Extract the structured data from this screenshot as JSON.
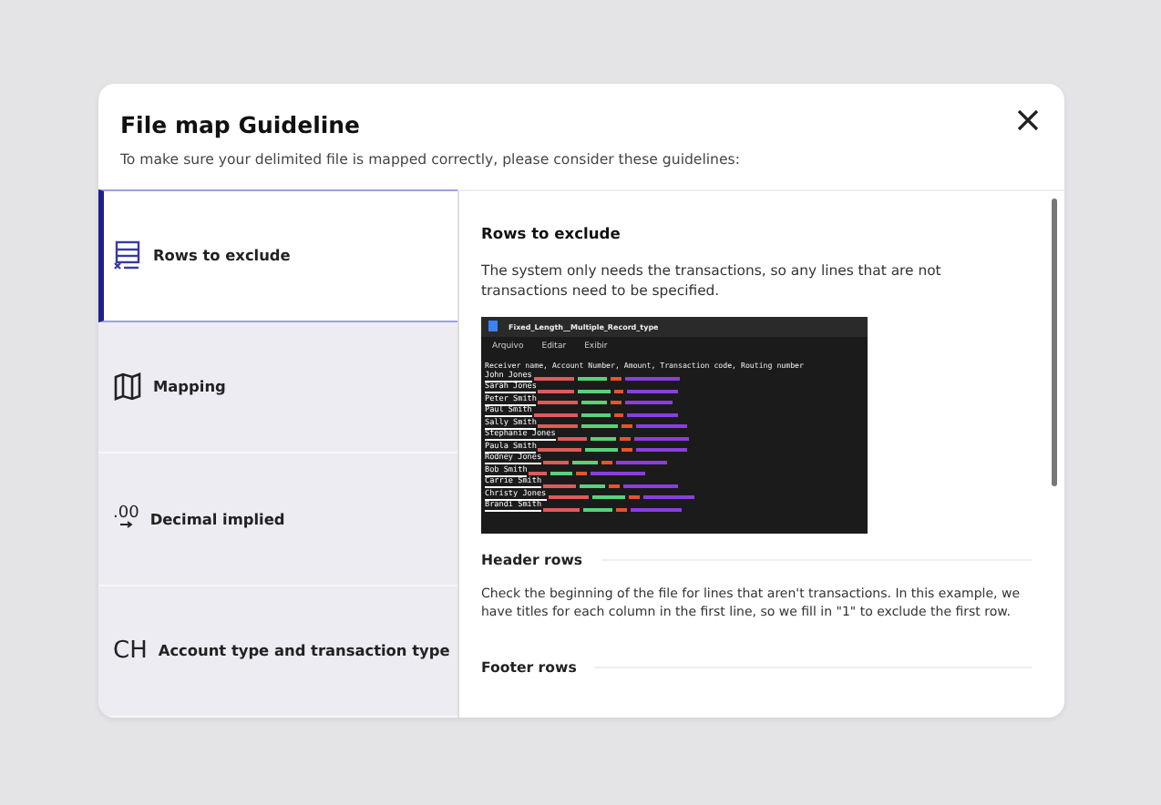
{
  "dialog": {
    "title": "File map Guideline",
    "subtitle": "To make sure your delimited file is mapped correctly, please consider these guidelines:"
  },
  "tabs": [
    {
      "label": "Rows to exclude",
      "kind": "rows",
      "selected": true
    },
    {
      "label": "Mapping",
      "kind": "map",
      "selected": false
    },
    {
      "label": "Decimal implied",
      "kind": "decimal",
      "glyph": ".00",
      "selected": false
    },
    {
      "label": "Account type and transaction type",
      "kind": "letters",
      "glyph": "CH",
      "selected": false
    }
  ],
  "content": {
    "heading": "Rows to exclude",
    "intro": "The system only needs the transactions, so any lines that are not transactions need to be specified.",
    "screenshot": {
      "tab_title": "Fixed_Length__Multiple_Record_type",
      "menu": [
        "Arquivo",
        "Editar",
        "Exibir"
      ],
      "header_line": "Receiver name, Account Number, Amount, Transaction code, Routing number",
      "rows": [
        "John Jones",
        "Sarah Jones",
        "Peter Smith",
        "Paul Smith",
        "Sally Smith",
        "Stephanie Jones",
        "Paula Smith",
        "Rodney Jones",
        "Bob Smith",
        "Carrie Smith",
        "Christy Jones",
        "Brandi Smith"
      ]
    },
    "sections": [
      {
        "title": "Header rows",
        "text": "Check the beginning of the file for lines that aren't transactions. In this example, we have titles for each column in the first line, so we fill in \"1\" to exclude the first row."
      },
      {
        "title": "Footer rows"
      }
    ]
  }
}
